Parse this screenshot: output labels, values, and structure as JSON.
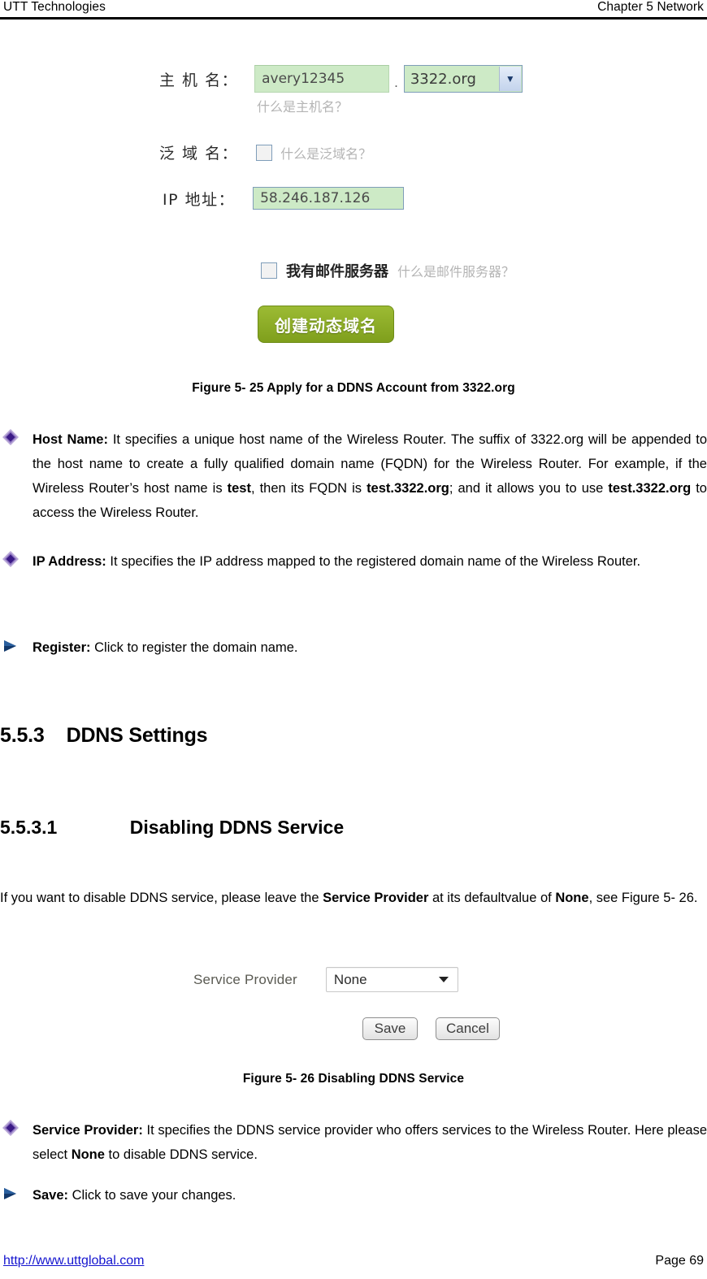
{
  "header": {
    "left": "UTT Technologies",
    "right": "Chapter 5 Network"
  },
  "figure_ddns_apply": {
    "host_name_label": "主 机 名：",
    "host_name_value": "avery12345",
    "dot_separator": ".",
    "domain_suffix": "3322.org",
    "dropdown_icon": "chevron-down-icon",
    "host_name_hint": "什么是主机名？",
    "wildcard_label": "泛 域 名：",
    "wildcard_hint": "什么是泛域名？",
    "ip_label": "IP 地址：",
    "ip_value": "58.246.187.126",
    "mail_server_label": "我有邮件服务器",
    "mail_server_hint": "什么是邮件服务器？",
    "create_button": "创建动态域名",
    "caption": "Figure 5- 25 Apply for a DDNS Account from 3322.org"
  },
  "bullets": {
    "host_name": {
      "icon": "diamond-bullet-icon",
      "term": "Host Name:",
      "text": " It specifies a unique host name of the Wireless Router. The suffix of 3322.org will be appended to the host name to create a fully qualified domain name (FQDN) for the Wireless Router. For example, if the Wireless Router’s host name is ",
      "term2": "test",
      "text2": ", then its FQDN is ",
      "term3": "test.3322.org",
      "text3": "; and it allows you to use ",
      "term4": "test.3322.org",
      "text4": " to access the Wireless Router."
    },
    "ip_address": {
      "icon": "diamond-bullet-icon",
      "term": "IP Address:",
      "text": " It specifies the IP address mapped to the registered domain name of the Wireless Router."
    },
    "register": {
      "icon": "arrow-bullet-icon",
      "term": "Register:",
      "text": " Click to register the domain name."
    },
    "service_provider": {
      "icon": "diamond-bullet-icon",
      "term": "Service Provider:",
      "text": " It specifies the DDNS service provider who offers services to the Wireless Router. Here please select ",
      "term2": "None",
      "text2": " to disable DDNS service."
    },
    "save": {
      "icon": "arrow-bullet-icon",
      "term": "Save:",
      "text": " Click to save your changes."
    }
  },
  "headings": {
    "section": "5.5.3    DDNS Settings",
    "subsection": "5.5.3.1              Disabling DDNS Service"
  },
  "intro": {
    "line1_a": "If you want to disable DDNS service, please leave the ",
    "line1_b": "Service Provider",
    "line1_c": " at its default",
    "line2_a": "value of ",
    "line2_b": "None",
    "line2_c": ", see Figure 5- 26."
  },
  "figure_disabling_ddns": {
    "service_provider_label": "Service Provider",
    "service_provider_value": "None",
    "dropdown_icon": "chevron-down-icon",
    "save_button": "Save",
    "cancel_button": "Cancel",
    "caption": "Figure 5- 26 Disabling DDNS Service"
  },
  "footer": {
    "url": "http://www.uttglobal.com",
    "page": "Page 69"
  },
  "colors": {
    "input_green": "#cdeac6",
    "create_button_green": "#8fae28",
    "link_blue": "#1414cf",
    "diamond_purple": "#5b2d93"
  }
}
